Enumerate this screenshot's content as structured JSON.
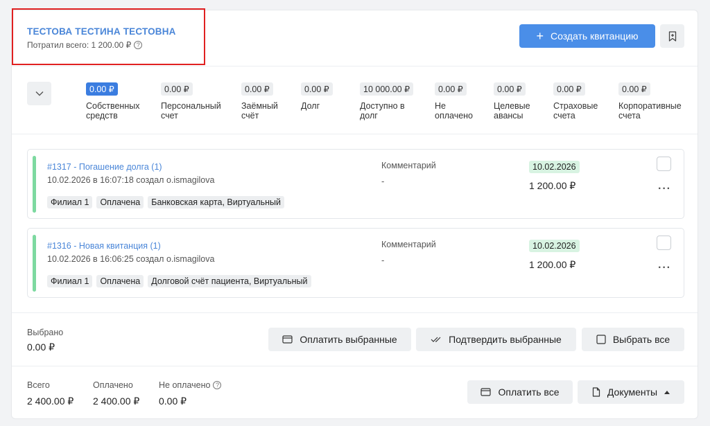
{
  "header": {
    "patient_name": "ТЕСТОВА ТЕСТИНА ТЕСТОВНА",
    "spent_text": "Потратил всего: 1 200.00 ₽",
    "create_button": "Создать квитанцию"
  },
  "balances": [
    {
      "amount": "0.00 ₽",
      "label": "Собственных средств",
      "active": true
    },
    {
      "amount": "0.00 ₽",
      "label": "Персональный счет"
    },
    {
      "amount": "0.00 ₽",
      "label": "Заёмный счёт"
    },
    {
      "amount": "0.00 ₽",
      "label": "Долг"
    },
    {
      "amount": "10 000.00 ₽",
      "label": "Доступно в долг"
    },
    {
      "amount": "0.00 ₽",
      "label": "Не оплачено"
    },
    {
      "amount": "0.00 ₽",
      "label": "Целевые авансы"
    },
    {
      "amount": "0.00 ₽",
      "label": "Страховые счета"
    },
    {
      "amount": "0.00 ₽",
      "label": "Корпоративные счета"
    }
  ],
  "receipts": [
    {
      "title": "#1317 - Погашение долга (1)",
      "meta": "10.02.2026 в 16:07:18 создал o.ismagilova",
      "tags": [
        "Филиал 1",
        "Оплачена",
        "Банковская карта, Виртуальный"
      ],
      "comment_label": "Комментарий",
      "comment": "-",
      "date": "10.02.2026",
      "sum": "1 200.00 ₽"
    },
    {
      "title": "#1316 - Новая квитанция (1)",
      "meta": "10.02.2026 в 16:06:25 создал o.ismagilova",
      "tags": [
        "Филиал 1",
        "Оплачена",
        "Долговой счёт пациента, Виртуальный"
      ],
      "comment_label": "Комментарий",
      "comment": "-",
      "date": "10.02.2026",
      "sum": "1 200.00 ₽"
    }
  ],
  "selection": {
    "label": "Выбрано",
    "value": "0.00 ₽",
    "pay_selected": "Оплатить выбранные",
    "confirm_selected": "Подтвердить выбранные",
    "select_all": "Выбрать все"
  },
  "totals": {
    "total_label": "Всего",
    "total_value": "2 400.00 ₽",
    "paid_label": "Оплачено",
    "paid_value": "2 400.00 ₽",
    "unpaid_label": "Не оплачено",
    "unpaid_value": "0.00 ₽",
    "pay_all": "Оплатить все",
    "documents": "Документы"
  },
  "colors": {
    "accent": "#4a8ee8",
    "active_badge": "#3b7de0",
    "status_stripe": "#7dd9a0",
    "date_badge": "#d8f3e2",
    "highlight_border": "#e02020"
  }
}
